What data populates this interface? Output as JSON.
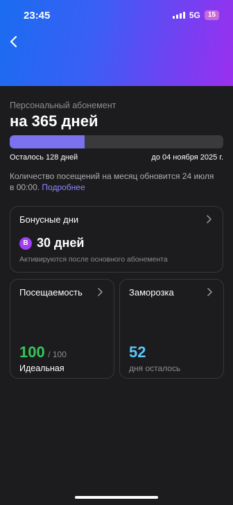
{
  "status": {
    "time": "23:45",
    "network": "5G",
    "battery": "15"
  },
  "subscription": {
    "type_label": "Персональный абонемент",
    "title": "на 365 дней",
    "progress_fraction": 0.35,
    "remaining": "Осталось 128 дней",
    "until": "до 04 ноября 2025 г.",
    "note": "Количество посещений на месяц обновится 24 июля в 00:00.",
    "more_link": "Подробнее"
  },
  "bonus": {
    "title": "Бонусные дни",
    "icon_letter": "B",
    "value": "30 дней",
    "subtitle": "Активируются после основного абонемента"
  },
  "attendance": {
    "title": "Посещаемость",
    "value": "100",
    "max": "/ 100",
    "label": "Идеальная"
  },
  "freeze": {
    "title": "Заморозка",
    "value": "52",
    "label": "дня осталось"
  },
  "colors": {
    "accent": "#7b72f0",
    "green": "#34c759",
    "blue": "#5ac8fa",
    "bonus_icon": "#a23ef3"
  },
  "icons": [
    "back-chevron-icon",
    "chevron-right-icon",
    "signal-icon",
    "battery-icon"
  ]
}
